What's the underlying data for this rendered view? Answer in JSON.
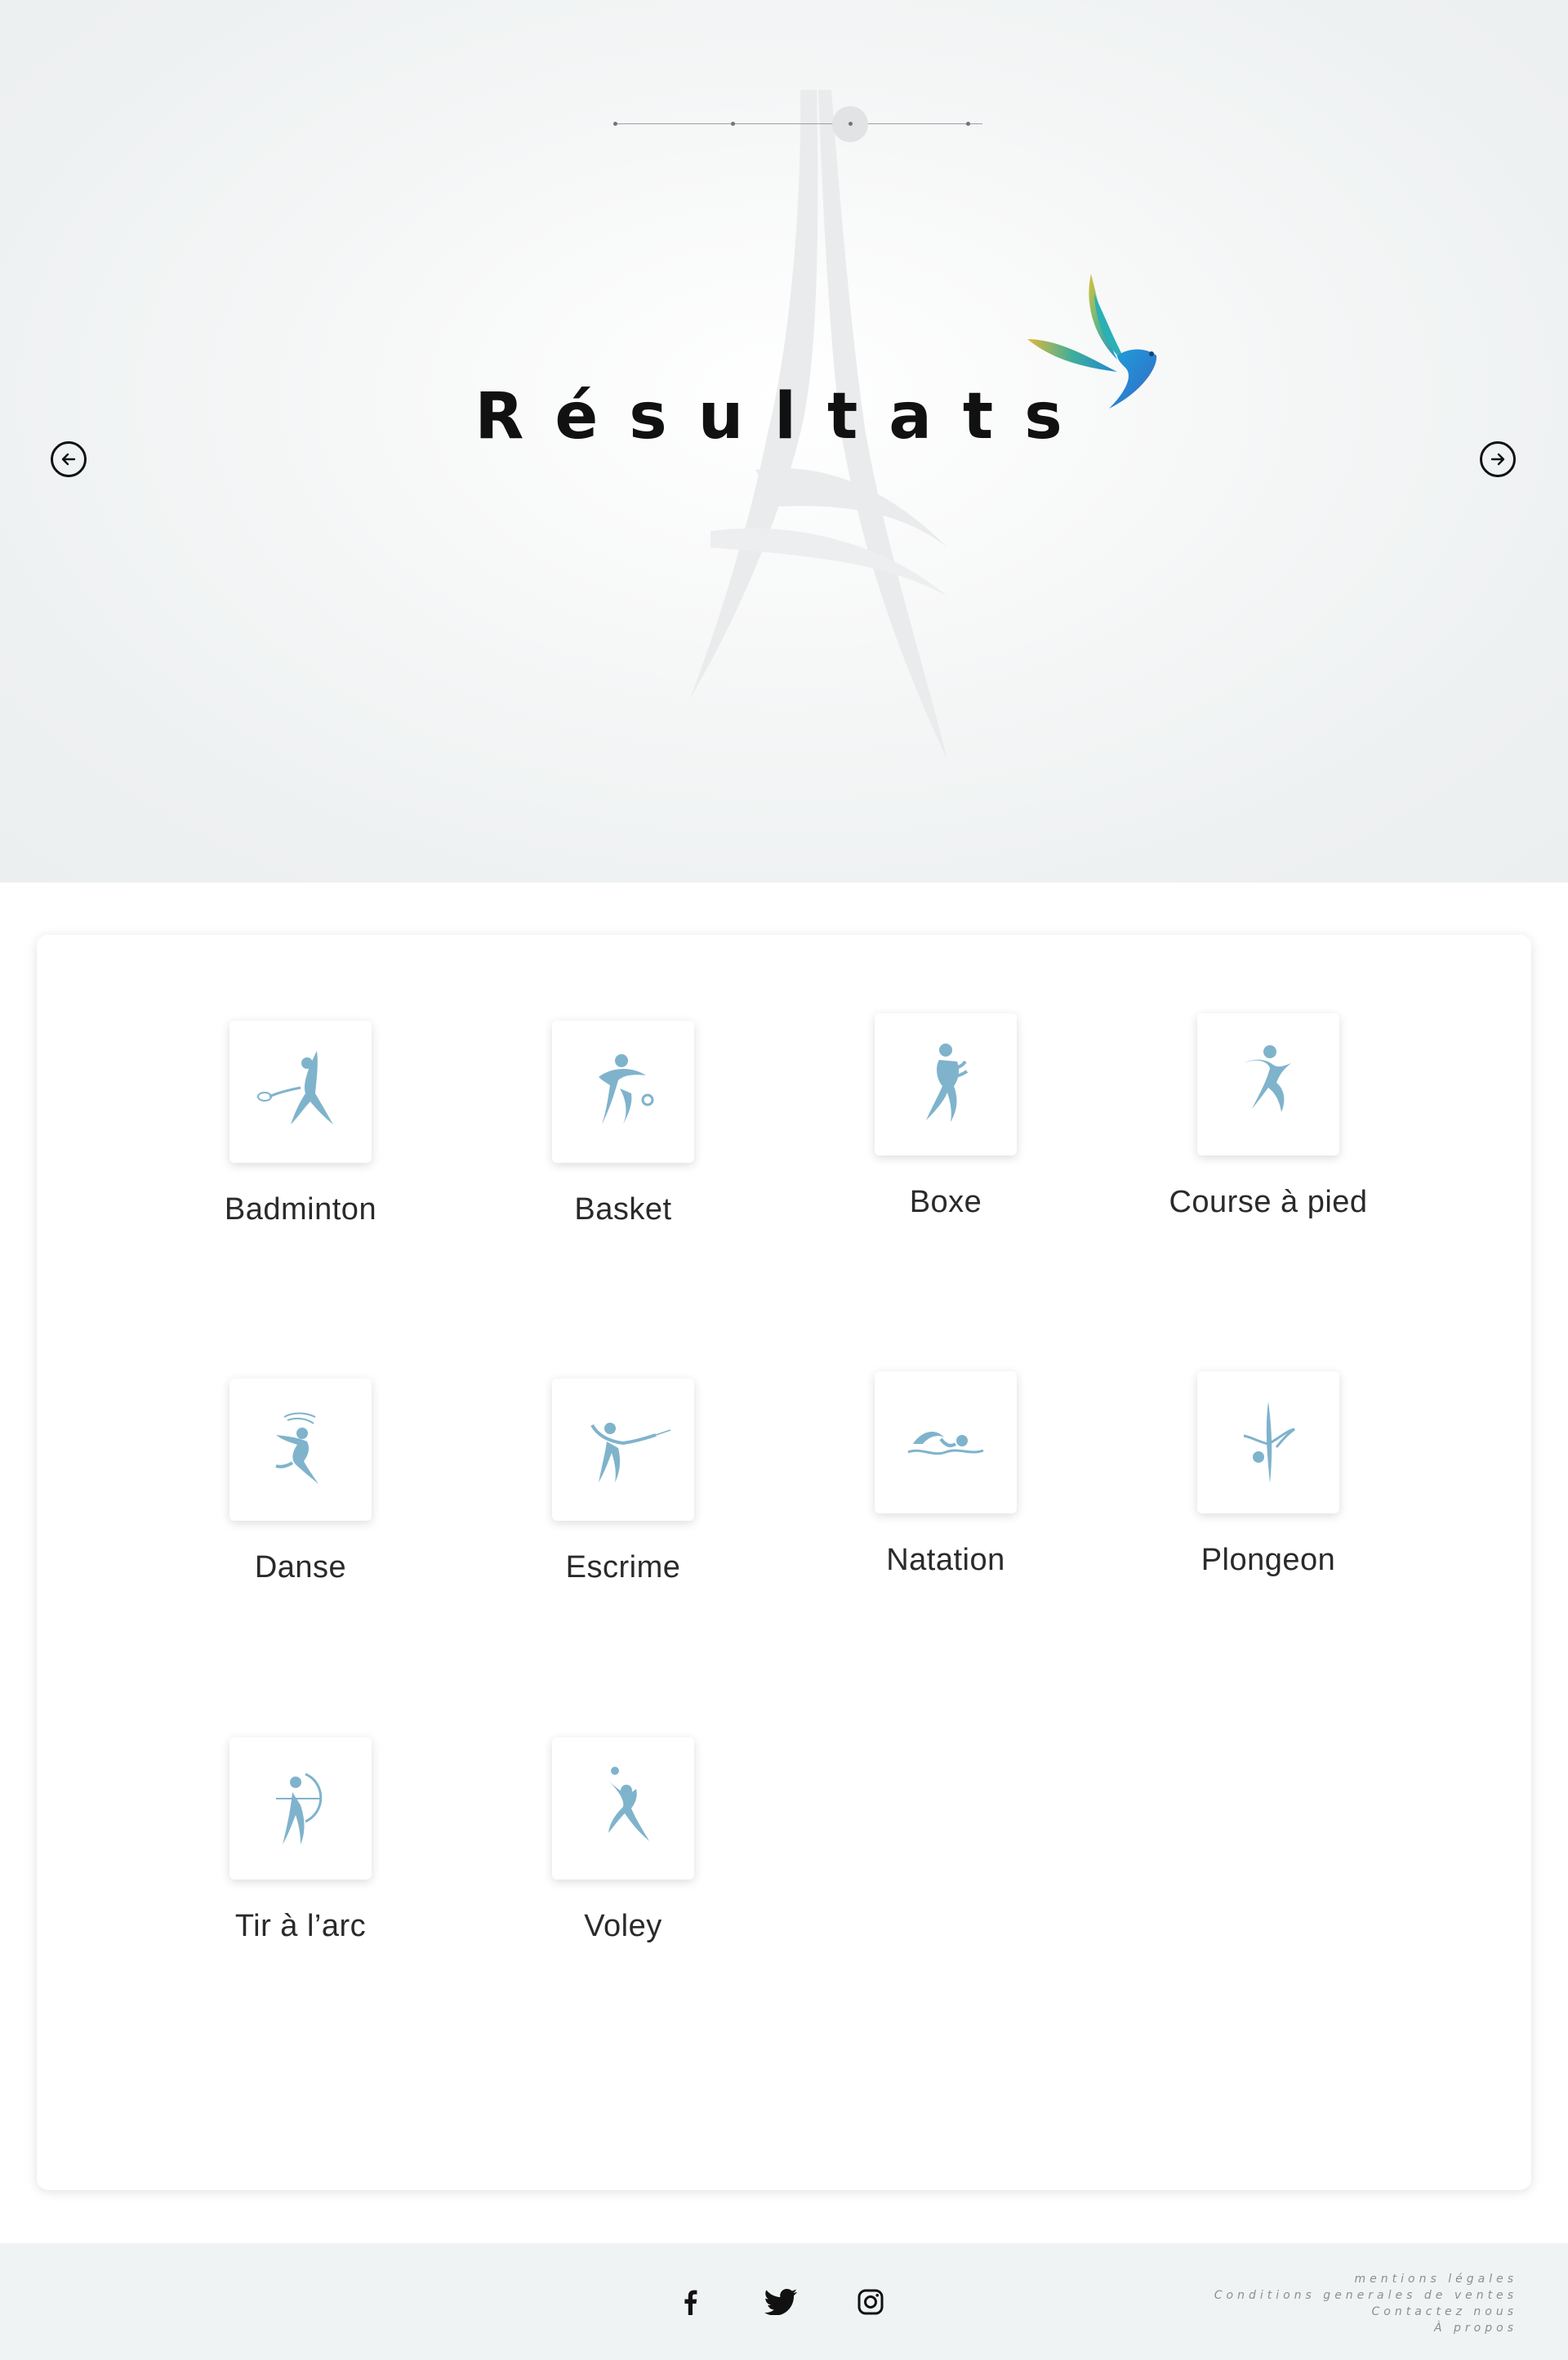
{
  "hero": {
    "title": "Résultats",
    "prev_icon": "arrow-left-icon",
    "next_icon": "arrow-right-icon",
    "stepper": {
      "steps": 4,
      "active_step": 3
    }
  },
  "sports": [
    {
      "label": "Badminton",
      "icon": "badminton-icon"
    },
    {
      "label": "Basket",
      "icon": "basketball-icon"
    },
    {
      "label": "Boxe",
      "icon": "boxing-icon"
    },
    {
      "label": "Course à pied",
      "icon": "running-icon"
    },
    {
      "label": "Danse",
      "icon": "dance-icon"
    },
    {
      "label": "Escrime",
      "icon": "fencing-icon"
    },
    {
      "label": "Natation",
      "icon": "swimming-icon"
    },
    {
      "label": "Plongeon",
      "icon": "diving-icon"
    },
    {
      "label": "Tir à l’arc",
      "icon": "archery-icon"
    },
    {
      "label": "Voley",
      "icon": "volleyball-icon"
    }
  ],
  "colors": {
    "icon_blue": "#7fb3cc",
    "text_dark": "#111111",
    "footer_bg": "#f0f3f4"
  },
  "footer": {
    "social": [
      "facebook-icon",
      "twitter-icon",
      "instagram-icon"
    ],
    "links": {
      "mentions": "mentions légales",
      "cgv": "Conditions generales de ventes",
      "contact": "Contactez nous",
      "about": "À propos"
    }
  }
}
